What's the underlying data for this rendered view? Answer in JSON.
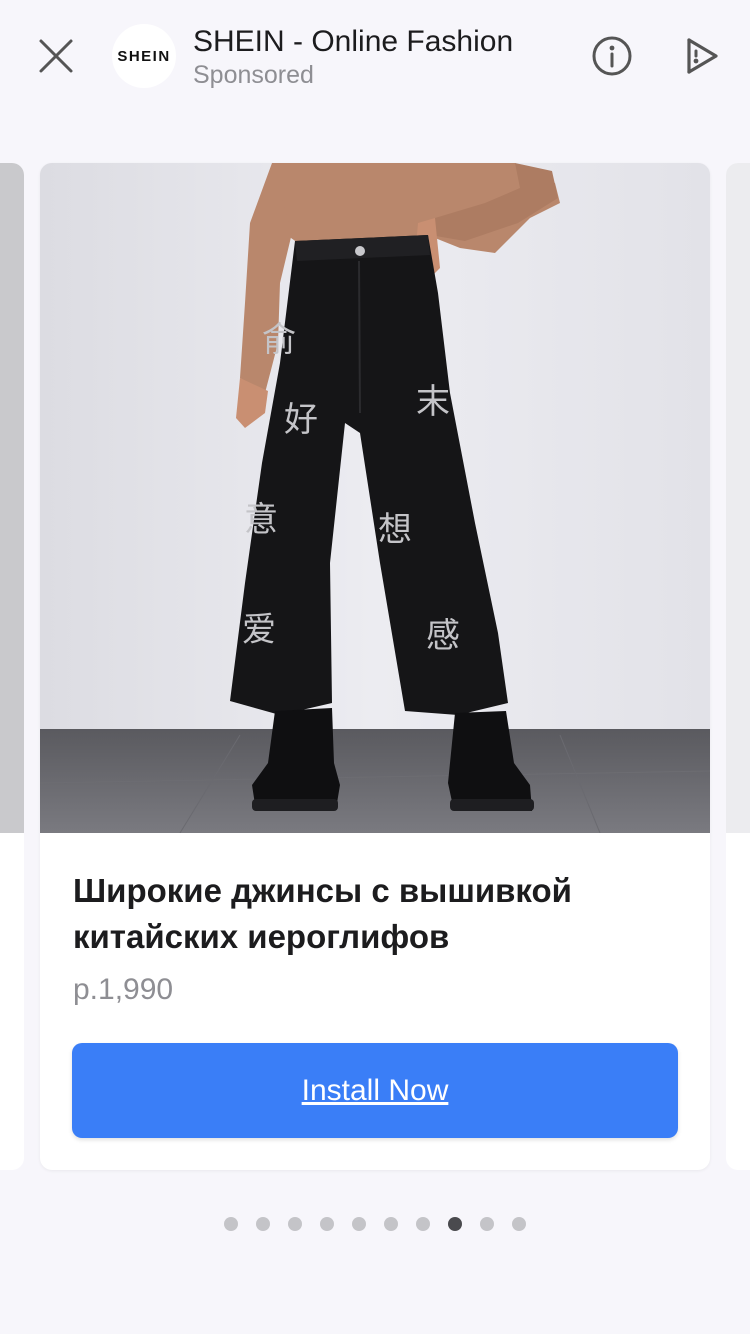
{
  "header": {
    "logo_text": "SHEIN",
    "app_name": "SHEIN - Online Fashion",
    "subtitle": "Sponsored",
    "icons": {
      "close": "close-icon",
      "info": "info-icon",
      "share": "share-icon"
    }
  },
  "card": {
    "title": "Широкие джинсы с вышивкой китайских иероглифов",
    "price": "р.1,990",
    "cta_label": "Install Now",
    "embroidery": [
      "俞",
      "好",
      "意",
      "爱",
      "末",
      "想",
      "感"
    ]
  },
  "pager": {
    "count": 10,
    "active_index": 7
  },
  "colors": {
    "accent": "#3a7ef7",
    "background": "#f7f6fb",
    "dot_inactive": "#c4c4c8",
    "dot_active": "#4a4a4e"
  }
}
